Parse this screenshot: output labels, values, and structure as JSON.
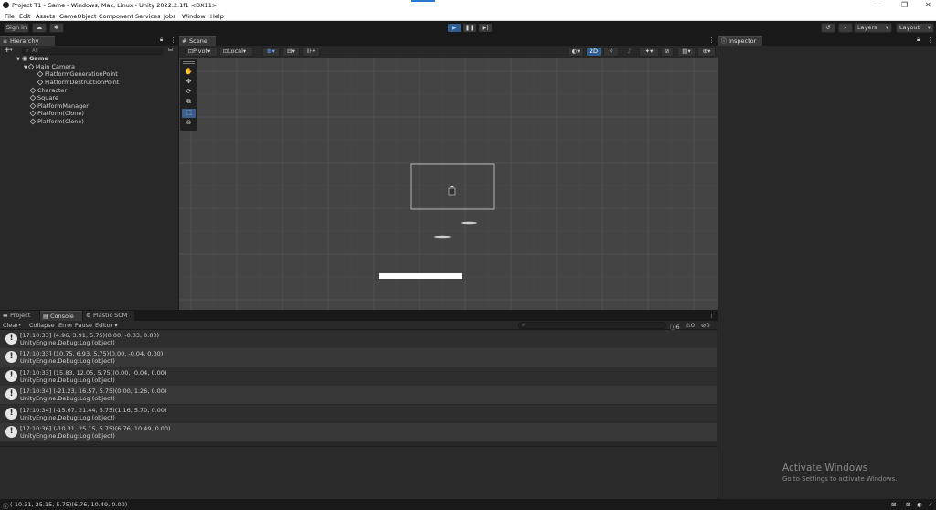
{
  "window": {
    "title": "Project T1 - Game - Windows, Mac, Linux - Unity 2022.2.1f1 <DX11>",
    "controls": [
      "–",
      "❐",
      "✕"
    ]
  },
  "menu": [
    "File",
    "Edit",
    "Assets",
    "GameObject",
    "Component",
    "Services",
    "Jobs",
    "Window",
    "Help"
  ],
  "toolbar": {
    "sign_in": "Sign in",
    "play_icon": "play-icon",
    "layers_label": "Layers",
    "layout_label": "Layout"
  },
  "hierarchy": {
    "tab_label": "Hierarchy",
    "search_placeholder": "All",
    "scene_name": "Game",
    "items": [
      {
        "label": "Main Camera"
      },
      {
        "label": "PlatformGenerationPoint"
      },
      {
        "label": "PlatformDestructionPoint"
      },
      {
        "label": "Character"
      },
      {
        "label": "Square"
      },
      {
        "label": "PlatformManager"
      },
      {
        "label": "Platform(Clone)"
      },
      {
        "label": "Platform(Clone)"
      }
    ]
  },
  "scene": {
    "tab_label": "Scene",
    "pivot_label": "Pivot",
    "local_label": "Local",
    "mode_2d": "2D"
  },
  "inspector": {
    "tab_label": "Inspector"
  },
  "bottom": {
    "tabs": [
      "Project",
      "Console",
      "Plastic SCM"
    ],
    "console_buttons": [
      "Clear",
      "Collapse",
      "Error Pause",
      "Editor"
    ],
    "counts": {
      "info": "6",
      "warn": "0",
      "error": "0"
    },
    "logs": [
      {
        "line1": "[17:10:33] (4.96, 3.91, 5.75)(0.00, -0.03, 0.00)",
        "line2": "UnityEngine.Debug:Log (object)"
      },
      {
        "line1": "[17:10:33] (10.75, 6.93, 5.75)(0.00, -0.04, 0.00)",
        "line2": "UnityEngine.Debug:Log (object)"
      },
      {
        "line1": "[17:10:33] (15.83, 12.05, 5.75)(0.00, -0.04, 0.00)",
        "line2": "UnityEngine.Debug:Log (object)"
      },
      {
        "line1": "[17:10:34] (-21.23, 16.57, 5.75)(0.00, 1.26, 0.00)",
        "line2": "UnityEngine.Debug:Log (object)"
      },
      {
        "line1": "[17:10:34] (-15.67, 21.44, 5.75)(1.16, 5.70, 0.00)",
        "line2": "UnityEngine.Debug:Log (object)"
      },
      {
        "line1": "[17:10:36] (-10.31, 25.15, 5.75)(6.76, 10.49, 0.00)",
        "line2": "UnityEngine.Debug:Log (object)"
      }
    ]
  },
  "status": {
    "last_log": "(-10.31, 25.15, 5.75)(6.76, 10.49, 0.00)"
  },
  "watermark": {
    "title": "Activate Windows",
    "subtitle": "Go to Settings to activate Windows."
  }
}
